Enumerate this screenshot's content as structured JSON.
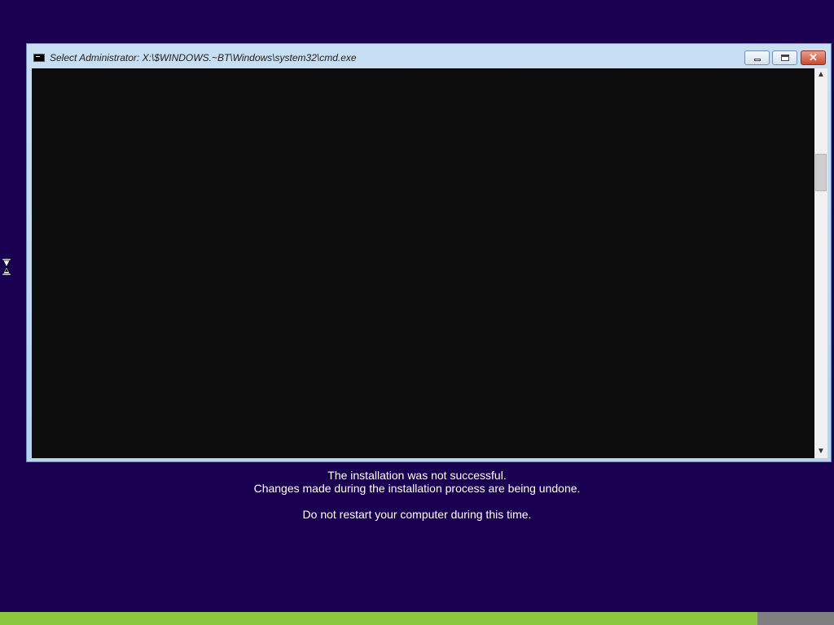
{
  "window": {
    "title": "Select Administrator: X:\\$WINDOWS.~BT\\Windows\\system32\\cmd.exe",
    "close_glyph": "✕",
    "scroll_up_glyph": "▲",
    "scroll_down_glyph": "▼",
    "icons": {
      "app": "console-icon",
      "minimize": "minimize-icon",
      "maximize": "restore-icon",
      "close": "close-icon"
    }
  },
  "messages": {
    "line1": "The installation was not successful.",
    "line2": "Changes made during the installation process are being undone.",
    "line3": "Do not restart your computer during this time."
  },
  "progress": {
    "fraction": 0.908
  },
  "colors": {
    "background": "#1a0050",
    "progress_fill": "#8cc63f",
    "progress_track": "#7f7f7f",
    "console": "#0c0c0c"
  }
}
